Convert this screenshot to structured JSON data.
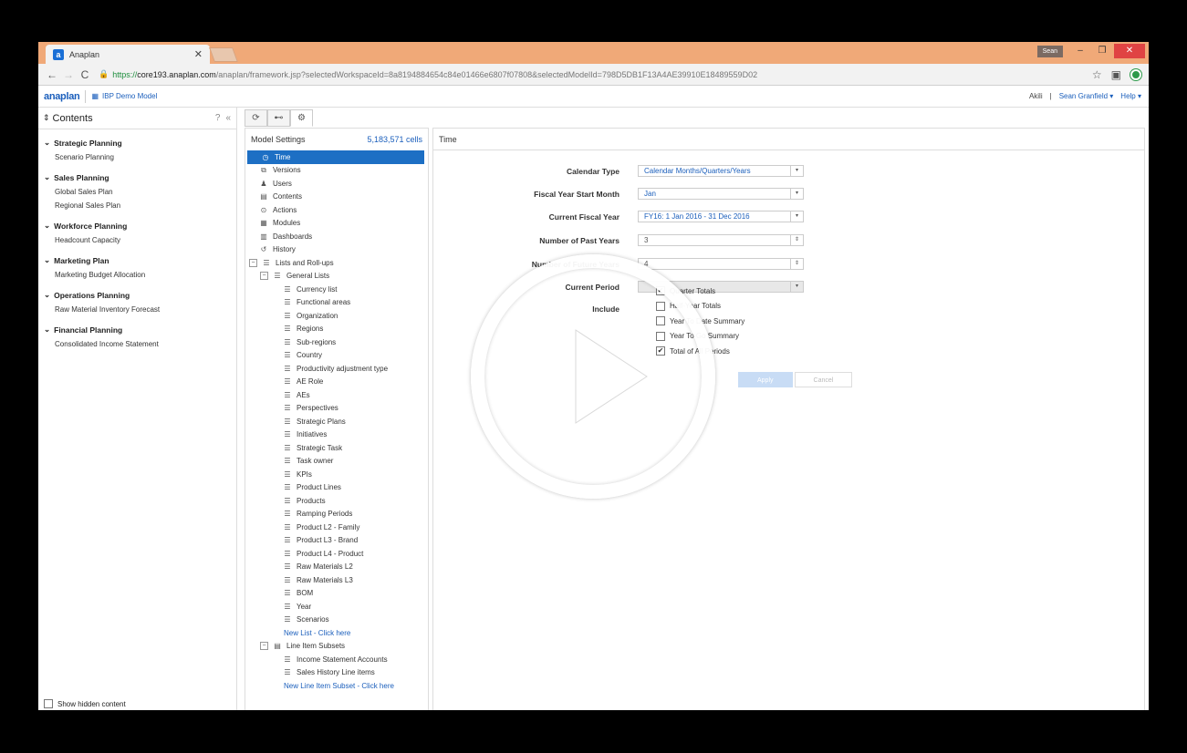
{
  "browser": {
    "tab_title": "Anaplan",
    "tab_favicon": "a",
    "profile_name": "Sean",
    "url_scheme": "https://",
    "url_host": "core193.anaplan.com",
    "url_path": "/anaplan/framework.jsp?selectedWorkspaceId=8a8194884654c84e01466e6807f07808&selectedModelId=798D5DB1F13A4AE39910E18489559D02"
  },
  "app": {
    "logo": "anaplan",
    "model_name": "IBP Demo Model",
    "user_first": "Akili",
    "user_menu": "Sean Granfield ▾",
    "help": "Help ▾"
  },
  "contents": {
    "title": "Contents",
    "sections": [
      {
        "title": "Strategic Planning",
        "items": [
          "Scenario Planning"
        ]
      },
      {
        "title": "Sales Planning",
        "items": [
          "Global Sales Plan",
          "Regional Sales Plan"
        ]
      },
      {
        "title": "Workforce Planning",
        "items": [
          "Headcount Capacity"
        ]
      },
      {
        "title": "Marketing Plan",
        "items": [
          "Marketing Budget Allocation"
        ]
      },
      {
        "title": "Operations Planning",
        "items": [
          "Raw Material Inventory Forecast"
        ]
      },
      {
        "title": "Financial Planning",
        "items": [
          "Consolidated Income Statement"
        ]
      }
    ],
    "show_hidden": "Show hidden content"
  },
  "settings": {
    "title": "Model Settings",
    "cells": "5,183,571 cells",
    "tree_top": [
      {
        "label": "Time",
        "icon": "clock-icon"
      },
      {
        "label": "Versions",
        "icon": "versions-icon"
      },
      {
        "label": "Users",
        "icon": "user-icon"
      },
      {
        "label": "Contents",
        "icon": "contents-icon"
      },
      {
        "label": "Actions",
        "icon": "actions-icon"
      },
      {
        "label": "Modules",
        "icon": "modules-icon"
      },
      {
        "label": "Dashboards",
        "icon": "dashboards-icon"
      },
      {
        "label": "History",
        "icon": "history-icon"
      }
    ],
    "lists_rollups": "Lists and Roll-ups",
    "general_lists": "General Lists",
    "lists": [
      "Currency list",
      "Functional areas",
      "Organization",
      "Regions",
      "Sub-regions",
      "Country",
      "Productivity adjustment type",
      "AE Role",
      "AEs",
      "Perspectives",
      "Strategic Plans",
      "Initiatives",
      "Strategic Task",
      "Task owner",
      "KPIs",
      "Product Lines",
      "Products",
      "Ramping Periods",
      "Product L2 - Family",
      "Product L3 - Brand",
      "Product L4 - Product",
      "Raw Materials L2",
      "Raw Materials L3",
      "BOM",
      "Year",
      "Scenarios"
    ],
    "new_list": "New List - Click here",
    "line_item_subsets": "Line Item Subsets",
    "subsets": [
      "Income Statement Accounts",
      "Sales History Line items"
    ],
    "new_subset": "New Line Item Subset - Click here"
  },
  "time": {
    "header": "Time",
    "calendar_type_label": "Calendar Type",
    "calendar_type": "Calendar Months/Quarters/Years",
    "fy_start_label": "Fiscal Year Start Month",
    "fy_start": "Jan",
    "current_fy_label": "Current Fiscal Year",
    "current_fy": "FY16: 1 Jan 2016 - 31 Dec 2016",
    "past_years_label": "Number of Past Years",
    "past_years": "3",
    "future_years_label": "Number of Future Years",
    "future_years": "4",
    "current_period_label": "Current Period",
    "current_period": "",
    "include_label": "Include",
    "include_options": [
      {
        "label": "Quarter Totals",
        "checked": true
      },
      {
        "label": "Half-Year Totals",
        "checked": false
      },
      {
        "label": "Year To Date Summary",
        "checked": false
      },
      {
        "label": "Year To Go Summary",
        "checked": false
      },
      {
        "label": "Total of All Periods",
        "checked": true
      }
    ],
    "apply": "Apply",
    "cancel": "Cancel"
  }
}
